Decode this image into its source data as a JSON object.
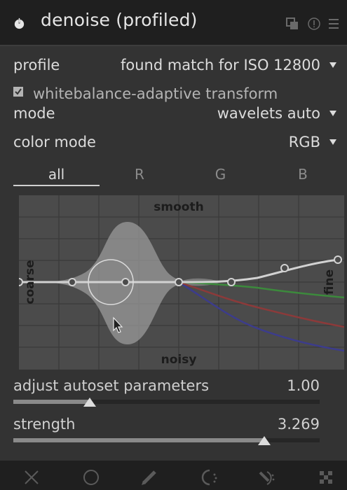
{
  "header": {
    "title": "denoise (profiled)",
    "icons": [
      "power-icon",
      "presets-icon",
      "reset-icon",
      "menu-icon"
    ]
  },
  "profile": {
    "label": "profile",
    "value": "found match for ISO 12800"
  },
  "whitebalance": {
    "label": "whitebalance-adaptive transform",
    "checked": true
  },
  "mode": {
    "label": "mode",
    "value": "wavelets auto"
  },
  "color_mode": {
    "label": "color mode",
    "value": "RGB"
  },
  "tabs": [
    {
      "label": "all",
      "active": true
    },
    {
      "label": "R",
      "active": false
    },
    {
      "label": "G",
      "active": false
    },
    {
      "label": "B",
      "active": false
    }
  ],
  "graph": {
    "top_label": "smooth",
    "bottom_label": "noisy",
    "left_label": "coarse",
    "right_label": "fine",
    "colors": {
      "all": "#d2d2d2",
      "R": "#8c3a3a",
      "G": "#3c8a3c",
      "B": "#3c3c8c"
    }
  },
  "sliders": [
    {
      "label": "adjust autoset parameters",
      "value": "1.00",
      "level": 0.25
    },
    {
      "label": "strength",
      "value": "3.269",
      "level": 0.82
    }
  ],
  "footer": {
    "icons": [
      "blend-off-icon",
      "blend-uniform-icon",
      "blend-drawn-icon",
      "blend-parametric-icon",
      "blend-drawn-parametric-icon",
      "blend-raster-icon"
    ]
  }
}
